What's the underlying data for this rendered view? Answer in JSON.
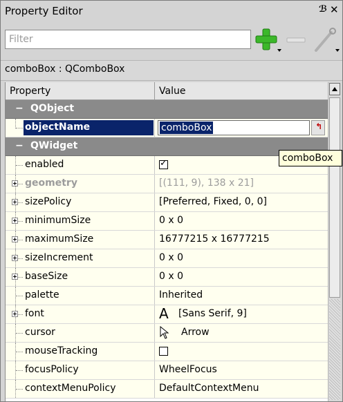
{
  "window": {
    "title": "Property Editor"
  },
  "toolbar": {
    "filter_placeholder": "Filter"
  },
  "class_label": "comboBox : QComboBox",
  "columns": {
    "property": "Property",
    "value": "Value"
  },
  "groups": {
    "qobject": "QObject",
    "qwidget": "QWidget"
  },
  "properties": {
    "objectName": {
      "name": "objectName",
      "value": "comboBox"
    },
    "enabled": {
      "name": "enabled",
      "checked": true
    },
    "geometry": {
      "name": "geometry",
      "value": "[(111, 9), 138 x 21]"
    },
    "sizePolicy": {
      "name": "sizePolicy",
      "value": "[Preferred, Fixed, 0, 0]"
    },
    "minimumSize": {
      "name": "minimumSize",
      "value": "0 x 0"
    },
    "maximumSize": {
      "name": "maximumSize",
      "value": "16777215 x 16777215"
    },
    "sizeIncrement": {
      "name": "sizeIncrement",
      "value": "0 x 0"
    },
    "baseSize": {
      "name": "baseSize",
      "value": "0 x 0"
    },
    "palette": {
      "name": "palette",
      "value": "Inherited"
    },
    "font": {
      "name": "font",
      "glyph": "A",
      "value": "[Sans Serif, 9]"
    },
    "cursor": {
      "name": "cursor",
      "value": "Arrow"
    },
    "mouseTracking": {
      "name": "mouseTracking",
      "checked": false
    },
    "focusPolicy": {
      "name": "focusPolicy",
      "value": "WheelFocus"
    },
    "contextMenuPolicy": {
      "name": "contextMenuPolicy",
      "value": "DefaultContextMenu"
    }
  },
  "tooltip": "comboBox",
  "colors": {
    "group_header": "#8a8a8a",
    "row_background": "#ffffef",
    "selection": "#0a246a",
    "add_icon": "#3cb82a"
  }
}
